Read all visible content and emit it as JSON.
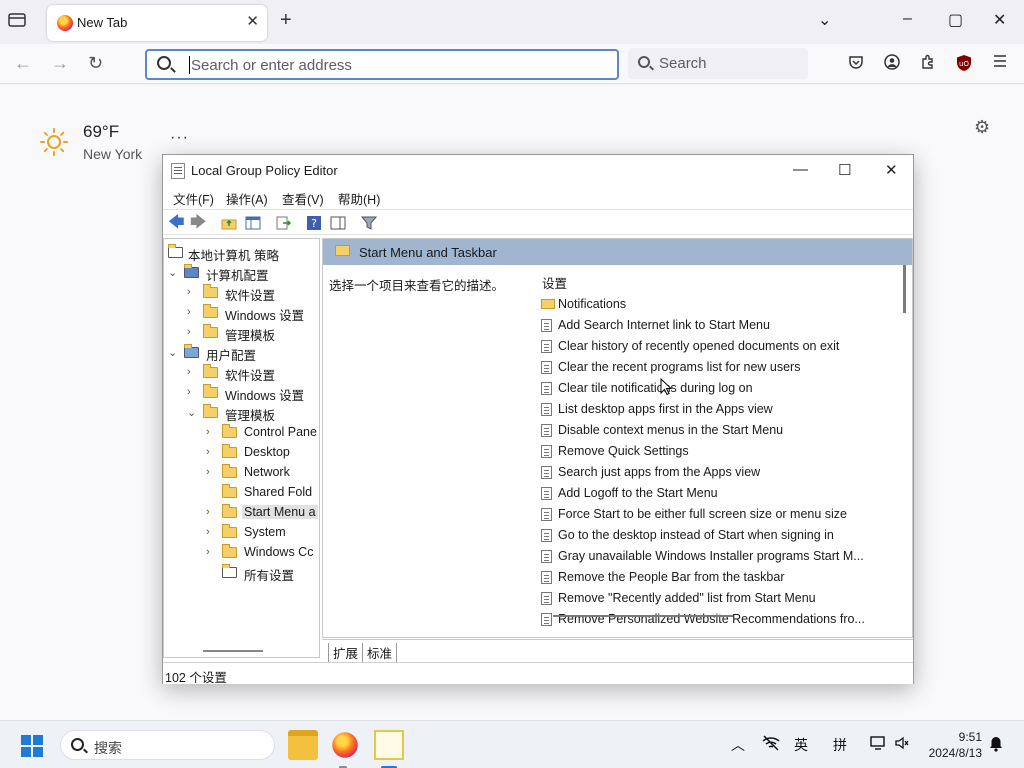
{
  "browser": {
    "tab": {
      "title": "New Tab",
      "close": "✕"
    },
    "new_tab_symbol": "+",
    "window_controls": {
      "list_all": "⌄",
      "minimize": "–",
      "maximize": "▢",
      "close": "✕"
    },
    "nav": {
      "back": "←",
      "forward": "→",
      "reload": "↻"
    },
    "address_placeholder": "Search or enter address",
    "search_placeholder": "Search",
    "toolbar_icons": [
      "pocket-icon",
      "account-icon",
      "extensions-icon",
      "ublock-icon",
      "menu-icon"
    ]
  },
  "newtab": {
    "weather": {
      "temp": "69°F",
      "city": "New York",
      "more": "···"
    },
    "settings_icon": "⚙"
  },
  "gpo": {
    "title": "Local Group Policy Editor",
    "window_controls": {
      "minimize": "—",
      "maximize": "☐",
      "close": "✕"
    },
    "menu": [
      "文件(F)",
      "操作(A)",
      "查看(V)",
      "帮助(H)"
    ],
    "tree": [
      {
        "label": "本地计算机 策略",
        "chev": "",
        "icon": "policy"
      },
      {
        "label": "计算机配置",
        "chev": "⌄",
        "icon": "computer"
      },
      {
        "label": "软件设置",
        "chev": "›",
        "icon": "folder"
      },
      {
        "label": "Windows 设置",
        "chev": "›",
        "icon": "folder"
      },
      {
        "label": "管理模板",
        "chev": "›",
        "icon": "folder"
      },
      {
        "label": "用户配置",
        "chev": "⌄",
        "icon": "user"
      },
      {
        "label": "软件设置",
        "chev": "›",
        "icon": "folder"
      },
      {
        "label": "Windows 设置",
        "chev": "›",
        "icon": "folder"
      },
      {
        "label": "管理模板",
        "chev": "⌄",
        "icon": "folder"
      },
      {
        "label": "Control Pane",
        "chev": "›",
        "icon": "folder"
      },
      {
        "label": "Desktop",
        "chev": "›",
        "icon": "folder"
      },
      {
        "label": "Network",
        "chev": "›",
        "icon": "folder"
      },
      {
        "label": "Shared Fold",
        "chev": "",
        "icon": "folder"
      },
      {
        "label": "Start Menu a",
        "chev": "›",
        "icon": "folder",
        "selected": true
      },
      {
        "label": "System",
        "chev": "›",
        "icon": "folder"
      },
      {
        "label": "Windows Cc",
        "chev": "›",
        "icon": "folder"
      },
      {
        "label": "所有设置",
        "chev": "",
        "icon": "all-settings"
      }
    ],
    "pane": {
      "heading": "Start Menu and Taskbar",
      "description": "选择一个项目来查看它的描述。",
      "column_header": "设置",
      "settings": [
        {
          "label": "Notifications",
          "kind": "folder"
        },
        {
          "label": "Add Search Internet link to Start Menu",
          "kind": "policy"
        },
        {
          "label": "Clear history of recently opened documents on exit",
          "kind": "policy"
        },
        {
          "label": "Clear the recent programs list for new users",
          "kind": "policy"
        },
        {
          "label": "Clear tile notifications during log on",
          "kind": "policy"
        },
        {
          "label": "List desktop apps first in the Apps view",
          "kind": "policy"
        },
        {
          "label": "Disable context menus in the Start Menu",
          "kind": "policy"
        },
        {
          "label": "Remove Quick Settings",
          "kind": "policy"
        },
        {
          "label": "Search just apps from the Apps view",
          "kind": "policy"
        },
        {
          "label": "Add Logoff to the Start Menu",
          "kind": "policy"
        },
        {
          "label": "Force Start to be either full screen size or menu size",
          "kind": "policy"
        },
        {
          "label": "Go to the desktop instead of Start when signing in",
          "kind": "policy"
        },
        {
          "label": "Gray unavailable Windows Installer programs Start M...",
          "kind": "policy"
        },
        {
          "label": "Remove the People Bar from the taskbar",
          "kind": "policy"
        },
        {
          "label": "Remove \"Recently added\" list from Start Menu",
          "kind": "policy"
        },
        {
          "label": "Remove Personalized Website Recommendations fro...",
          "kind": "policy"
        }
      ]
    },
    "bottom_tabs": [
      "扩展",
      "标准"
    ],
    "status": "102 个设置"
  },
  "taskbar": {
    "search_placeholder": "搜索",
    "tray": {
      "chevron": "︿",
      "ime_lang": "英",
      "ime_mode": "拼"
    },
    "time": "9:51",
    "date": "2024/8/13",
    "accent": "#1f7ad8"
  }
}
